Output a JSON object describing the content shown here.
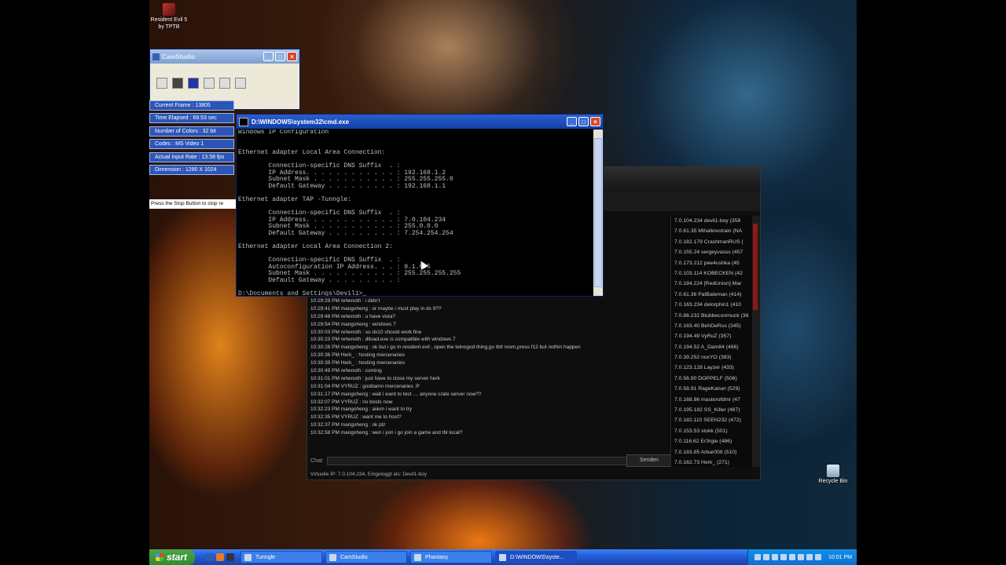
{
  "desktop": {
    "icons": [
      {
        "label": "Resident Evil 5\nby TPTB"
      },
      {
        "label": "Recycle Bin"
      }
    ]
  },
  "camstudio": {
    "title": "CamStudio",
    "stats": [
      "Current Frame : 13805",
      "Time Elapsed : 69.53 sec",
      "Number of Colors : 32 bit",
      "Codec : MS Video 1",
      "Actual Input Rate : 13.58 fps",
      "Dimension : 1280 X 1024"
    ],
    "stop_note": "Press the Stop Button to stop re"
  },
  "cmd": {
    "title": "D:\\WINDOWS\\system32\\cmd.exe",
    "lines": [
      "Windows IP Configuration",
      "",
      "",
      "Ethernet adapter Local Area Connection:",
      "",
      "        Connection-specific DNS Suffix  . :",
      "        IP Address. . . . . . . . . . . . : 192.168.1.2",
      "        Subnet Mask . . . . . . . . . . . : 255.255.255.0",
      "        Default Gateway . . . . . . . . . : 192.168.1.1",
      "",
      "Ethernet adapter TAP -Tunngle:",
      "",
      "        Connection-specific DNS Suffix  . :",
      "        IP Address. . . . . . . . . . . . : 7.0.104.234",
      "        Subnet Mask . . . . . . . . . . . : 255.0.0.0",
      "        Default Gateway . . . . . . . . . : 7.254.254.254",
      "",
      "Ethernet adapter Local Area Connection 2:",
      "",
      "        Connection-specific DNS Suffix  . :",
      "        Autoconfiguration IP Address. . . : 0.1.0.5",
      "        Subnet Mask . . . . . . . . . . . : 255.255.255.255",
      "        Default Gateway . . . . . . . . . :",
      "",
      "D:\\Documents and Settings\\Devil1>_"
    ]
  },
  "chat": {
    "messages": [
      "10:29:29 PM rehenoth : i didn't",
      "10:29:41 PM mangoheng : or maybe i must play in dx 9??",
      "10:29:48 PM rehenoth : u have vista?",
      "10:29:54 PM mangoheng : windows 7",
      "10:30:03 PM rehenoth : so dx10 should work fine",
      "10:30:23 PM rehenoth : dlload.exe is compatible with windows 7",
      "10:30:28 PM mangoheng : ok but i go in resident evil , open the telnogod thing,go tbtl room,press f12 but nothin happen",
      "10:30:36 PM Herk_ : hosting mercenaries",
      "10:30:39 PM Herk_ : hosting mercenaries",
      "10:30:49 PM rehenoth : coming",
      "10:31:01 PM rehenoth : just have to close my server herk",
      "10:31:04 PM VYRUZ : goddamn mercenaries :P",
      "10:31:17 PM mangoheng : wait i want to test .... anyone crate server now??",
      "10:32:07 PM VYRUZ : no bosts now",
      "10:32:23 PM mangoheng : aiiem i want to try",
      "10:32:35 PM VYRUZ : want me to host?",
      "10:32:37 PM mangoheng : ok plz",
      "10:32:58 PM mangoheng : wen i join i go join a game and tbl local?"
    ],
    "chat_label": "Chat:",
    "send_label": "Senden",
    "status": "Virtuelle IP: 7.0.104.234, Eingeloggt als: Devil1-boy",
    "users": [
      "7.0.104.234 devil1-boy (358",
      "7.0.61.35 Mihalkrestrain (NA",
      "7.0.182.179 CrashmanRUS (",
      "7.0.155.24 sergeyvasss (457",
      "7.0.173.212 pee4ushka (45",
      "7.0.103.114 KOBECKEN (42",
      "7.0.184.224 [RedUnion] Mar",
      "7.0.61.36 PatBateman (414)",
      "7.0.163.234 delorphin1 (410",
      "7.0.86.232 Blubbeconrnuck (36",
      "7.0.163.40 BehDeRus (345)",
      "7.0.194.49 VyRuZ (357)",
      "7.0.194.52 A_Dam84 (486)",
      "7.0.39.252 noxYO (383)",
      "7.0.123.128 Layzer (433)",
      "7.0.56.90 DOPPELF (506)",
      "7.0.58.91 RageKaiser (529)",
      "7.0.168.86 masterofdmr (47",
      "7.0.195.182 SS_Killer (487)",
      "7.0.182.110 SEEN232 (472)",
      "7.0.153.53 stokk (501)",
      "7.0.116.62 Er3rgie (486)",
      "7.0.183.85 Arbar008 (510)",
      "7.0.162.73 Herk_ (271)"
    ]
  },
  "taskbar": {
    "start_label": "start",
    "tasks": [
      "Tunngle",
      "CamStudio",
      "Phantasy",
      "D:\\WINDOWS\\syste..."
    ],
    "clock": "10:01 PM"
  }
}
